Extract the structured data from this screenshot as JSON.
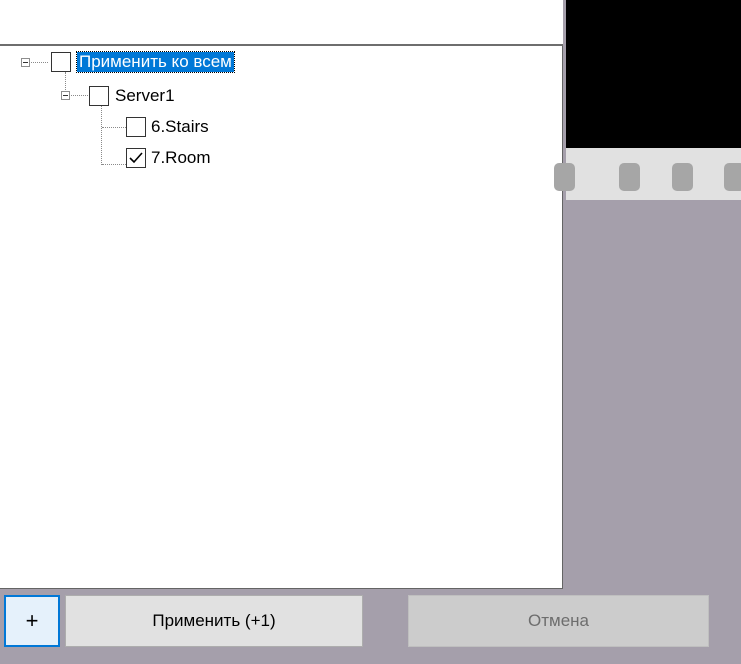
{
  "tree": {
    "root": {
      "label": "Применить ко всем",
      "checked": false,
      "expanded": true,
      "selected": true
    },
    "server": {
      "label": "Server1",
      "checked": false,
      "expanded": true
    },
    "cameras": [
      {
        "label": "6.Stairs",
        "checked": false
      },
      {
        "label": "7.Room",
        "checked": true
      }
    ]
  },
  "buttons": {
    "add_label": "+",
    "apply_label": "Применить (+1)",
    "cancel_label": "Отмена"
  },
  "colors": {
    "selection": "#0078d7",
    "background": "#a59fab"
  }
}
